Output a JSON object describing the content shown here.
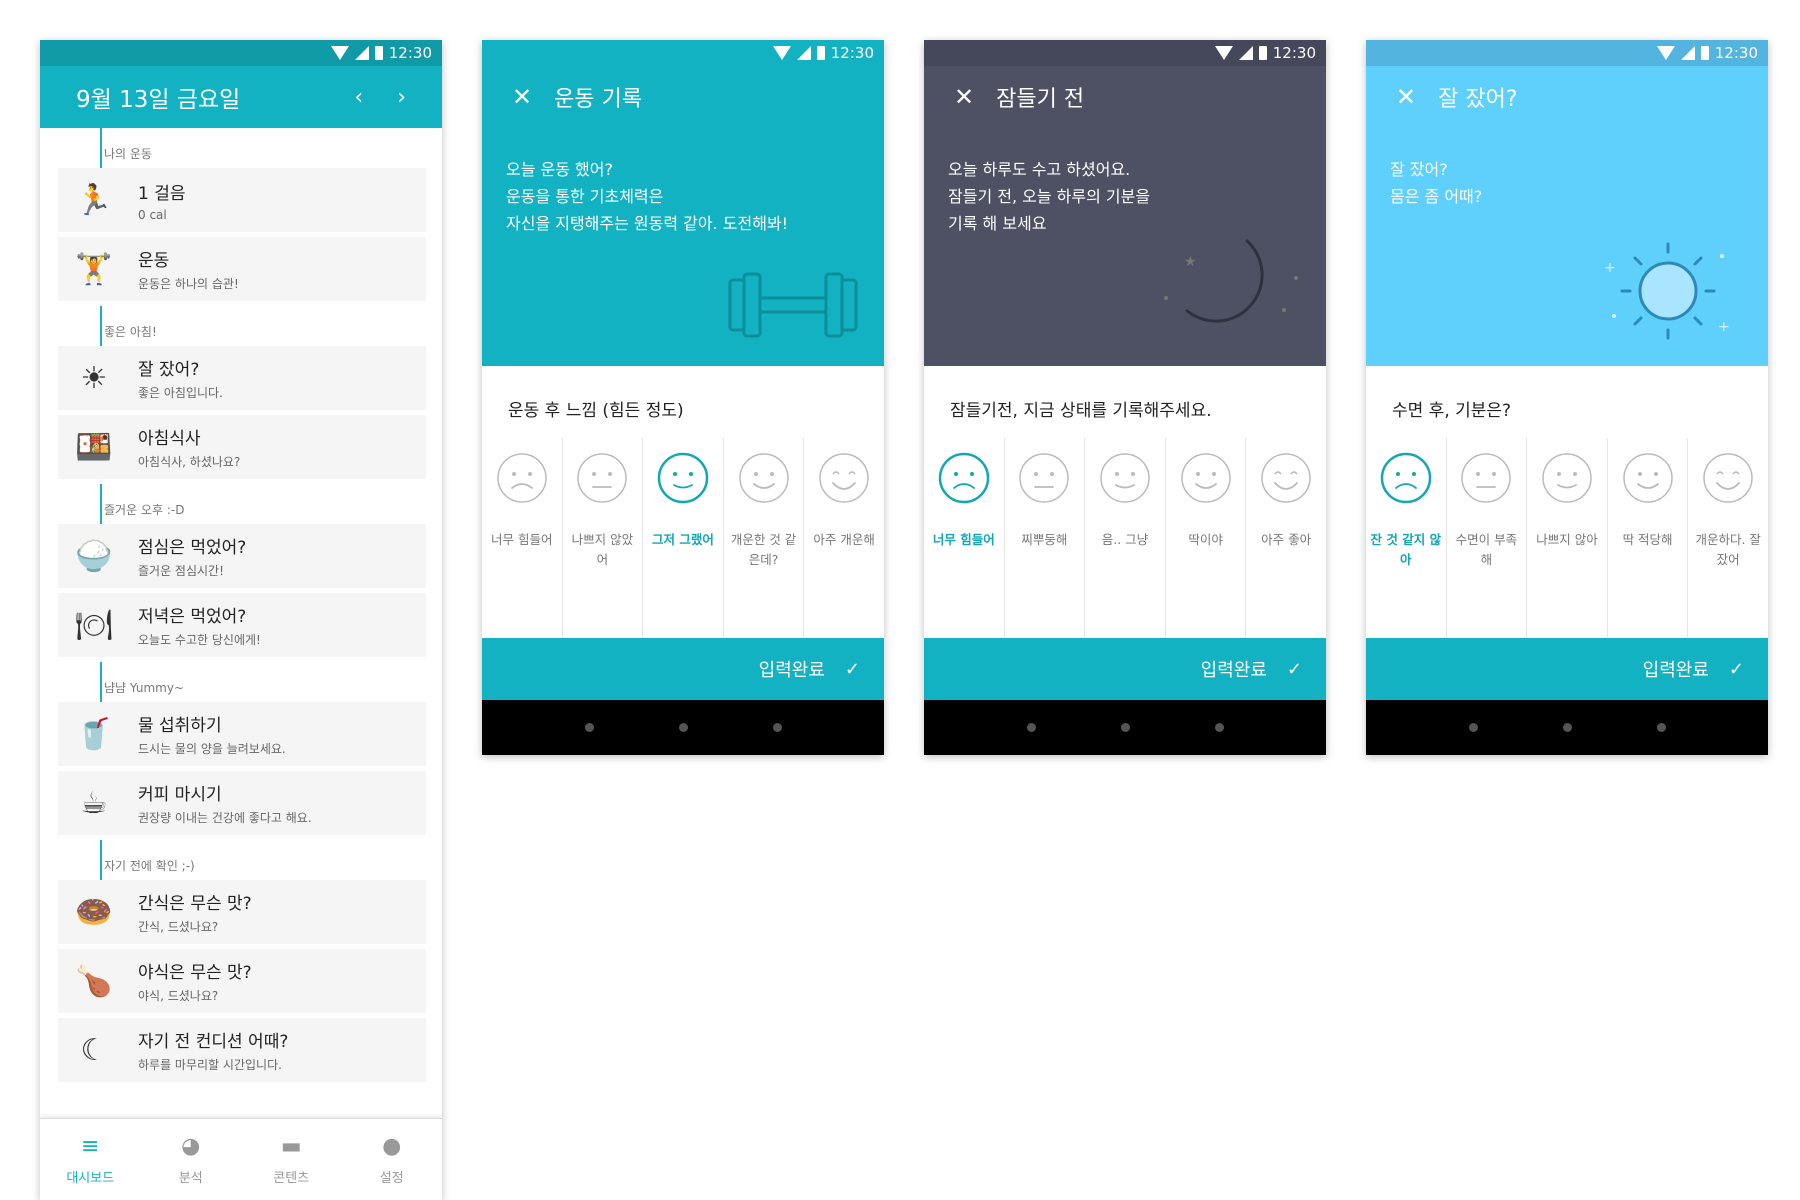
{
  "status_time": "12:30",
  "dashboard": {
    "date_title": "9월 13일 금요일",
    "prev": "‹",
    "next": "›",
    "sections": [
      {
        "label": "나의 운동",
        "items": [
          {
            "icon": "🏃",
            "icon_name": "running-shoe-icon",
            "title": "1 걸음",
            "sub": "0 cal"
          },
          {
            "icon": "🏋",
            "icon_name": "dumbbell-icon",
            "title": "운동",
            "sub": "운동은 하나의 습관!"
          }
        ]
      },
      {
        "label": "좋은 아침!",
        "items": [
          {
            "icon": "☀",
            "icon_name": "sun-icon",
            "title": "잘 잤어?",
            "sub": "좋은 아침입니다."
          },
          {
            "icon": "🍱",
            "icon_name": "breakfast-icon",
            "title": "아침식사",
            "sub": "아침식사, 하셨나요?"
          }
        ]
      },
      {
        "label": "즐거운 오후 :-D",
        "items": [
          {
            "icon": "🍚",
            "icon_name": "rice-bowl-icon",
            "title": "점심은 먹었어?",
            "sub": "즐거운 점심시간!"
          },
          {
            "icon": "🍽",
            "icon_name": "dinner-cloche-icon",
            "title": "저녁은 먹었어?",
            "sub": "오늘도 수고한 당신에게!"
          }
        ]
      },
      {
        "label": "냠냠 Yummy~",
        "items": [
          {
            "icon": "🥤",
            "icon_name": "water-cup-icon",
            "title": "물 섭취하기",
            "sub": "드시는 물의 양을 늘려보세요."
          },
          {
            "icon": "☕",
            "icon_name": "coffee-cup-icon",
            "title": "커피 마시기",
            "sub": "권장량 이내는 건강에 좋다고 해요."
          }
        ]
      },
      {
        "label": "자기 전에 확인 ;-)",
        "items": [
          {
            "icon": "🍩",
            "icon_name": "donut-icon",
            "title": "간식은 무슨 맛?",
            "sub": "간식, 드셨나요?"
          },
          {
            "icon": "🍗",
            "icon_name": "chicken-leg-icon",
            "title": "야식은 무슨 맛?",
            "sub": "야식, 드셨나요?"
          },
          {
            "icon": "☾",
            "icon_name": "moon-icon",
            "title": "자기 전 컨디션 어때?",
            "sub": "하루를 마무리할 시간입니다."
          }
        ]
      }
    ],
    "bottom_nav": [
      {
        "icon": "≡",
        "label": "대시보드",
        "active": true
      },
      {
        "icon": "◕",
        "label": "분석",
        "active": false
      },
      {
        "icon": "▬",
        "label": "콘텐츠",
        "active": false
      },
      {
        "icon": "●",
        "label": "설정",
        "active": false
      }
    ]
  },
  "screens": [
    {
      "id": "exercise",
      "status_color": "#13b2c2",
      "header_color": "#13b2c2",
      "title": "운동 기록",
      "desc": [
        "오늘 운동 했어?",
        "운동을 통한 기초체력은",
        "자신을 지탱해주는 원동력 같아. 도전해봐!"
      ],
      "question": "운동 후 느낌 (힘든 정도)",
      "faces": [
        "너무 힘들어",
        "나쁘지 않았어",
        "그저 그랬어",
        "개운한 것 같은데?",
        "아주 개운해"
      ],
      "selected": 2,
      "done": "입력완료"
    },
    {
      "id": "before-sleep",
      "status_color": "#44485a",
      "header_color": "#4d5163",
      "title": "잠들기 전",
      "desc": [
        "오늘 하루도 수고 하셨어요.",
        "잠들기 전, 오늘 하루의 기분을",
        "기록 해 보세요"
      ],
      "question": "잠들기전, 지금 상태를 기록해주세요.",
      "faces": [
        "너무 힘들어",
        "찌뿌둥해",
        "음.. 그냥",
        "딱이야",
        "아주 좋아"
      ],
      "selected": 0,
      "done": "입력완료"
    },
    {
      "id": "slept-well",
      "status_color": "#53b4e0",
      "header_color": "#5fcffb",
      "title": "잘 잤어?",
      "desc": [
        "잘 잤어?",
        "몸은 좀 어때?"
      ],
      "question": "수면 후, 기분은?",
      "faces": [
        "잔 것 같지 않아",
        "수면이 부족해",
        "나쁘지 않아",
        "딱 적당해",
        "개운하다. 잘잤어"
      ],
      "selected": 0,
      "done": "입력완료"
    }
  ]
}
